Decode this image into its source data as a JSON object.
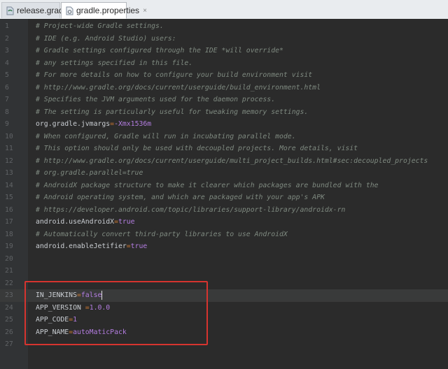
{
  "tabs": [
    {
      "label": "release.gradle",
      "close": "×",
      "icon": "gradle-file-icon",
      "active": false
    },
    {
      "label": "gradle.properties",
      "close": "×",
      "icon": "properties-file-icon",
      "active": true
    }
  ],
  "lines": [
    {
      "n": "1",
      "parts": [
        {
          "t": "# Project-wide Gradle settings.",
          "c": "comment"
        }
      ]
    },
    {
      "n": "2",
      "parts": [
        {
          "t": "# IDE (e.g. Android Studio) users:",
          "c": "comment"
        }
      ]
    },
    {
      "n": "3",
      "parts": [
        {
          "t": "# Gradle settings configured through the IDE *will override*",
          "c": "comment"
        }
      ]
    },
    {
      "n": "4",
      "parts": [
        {
          "t": "# any settings specified in this file.",
          "c": "comment"
        }
      ]
    },
    {
      "n": "5",
      "parts": [
        {
          "t": "# For more details on how to configure your build environment visit",
          "c": "comment"
        }
      ]
    },
    {
      "n": "6",
      "parts": [
        {
          "t": "# http://www.gradle.org/docs/current/userguide/build_environment.html",
          "c": "comment"
        }
      ]
    },
    {
      "n": "7",
      "parts": [
        {
          "t": "# Specifies the JVM arguments used for the daemon process.",
          "c": "comment"
        }
      ]
    },
    {
      "n": "8",
      "parts": [
        {
          "t": "# The setting is particularly useful for tweaking memory settings.",
          "c": "comment"
        }
      ]
    },
    {
      "n": "9",
      "parts": [
        {
          "t": "org.gradle.jvmargs",
          "c": "key"
        },
        {
          "t": "=",
          "c": "op"
        },
        {
          "t": "-Xmx1536m",
          "c": "strv"
        }
      ]
    },
    {
      "n": "10",
      "parts": [
        {
          "t": "# When configured, Gradle will run in incubating parallel mode.",
          "c": "comment"
        }
      ]
    },
    {
      "n": "11",
      "parts": [
        {
          "t": "# This option should only be used with decoupled projects. More details, visit",
          "c": "comment"
        }
      ]
    },
    {
      "n": "12",
      "parts": [
        {
          "t": "# http://www.gradle.org/docs/current/userguide/multi_project_builds.html#sec:decoupled_projects",
          "c": "comment"
        }
      ]
    },
    {
      "n": "13",
      "parts": [
        {
          "t": "# org.gradle.parallel=true",
          "c": "comment"
        }
      ]
    },
    {
      "n": "14",
      "parts": [
        {
          "t": "# AndroidX package structure to make it clearer which packages are bundled with the",
          "c": "comment"
        }
      ]
    },
    {
      "n": "15",
      "parts": [
        {
          "t": "# Android operating system, and which are packaged with your app's APK",
          "c": "comment"
        }
      ]
    },
    {
      "n": "16",
      "parts": [
        {
          "t": "# https://developer.android.com/topic/libraries/support-library/androidx-rn",
          "c": "comment"
        }
      ]
    },
    {
      "n": "17",
      "parts": [
        {
          "t": "android.useAndroidX",
          "c": "key"
        },
        {
          "t": "=",
          "c": "op"
        },
        {
          "t": "true",
          "c": "strv"
        }
      ]
    },
    {
      "n": "18",
      "parts": [
        {
          "t": "# Automatically convert third-party libraries to use AndroidX",
          "c": "comment"
        }
      ]
    },
    {
      "n": "19",
      "parts": [
        {
          "t": "android.enableJetifier",
          "c": "key"
        },
        {
          "t": "=",
          "c": "op"
        },
        {
          "t": "true",
          "c": "strv"
        }
      ]
    },
    {
      "n": "20",
      "parts": []
    },
    {
      "n": "21",
      "parts": []
    },
    {
      "n": "22",
      "parts": []
    },
    {
      "n": "23",
      "parts": [
        {
          "t": "IN_JENKINS",
          "c": "key"
        },
        {
          "t": "=",
          "c": "op"
        },
        {
          "t": "false",
          "c": "strv"
        }
      ],
      "current": true
    },
    {
      "n": "24",
      "parts": [
        {
          "t": "APP_VERSION ",
          "c": "key"
        },
        {
          "t": "=",
          "c": "op"
        },
        {
          "t": "1.0.0",
          "c": "strv"
        }
      ]
    },
    {
      "n": "25",
      "parts": [
        {
          "t": "APP_CODE",
          "c": "key"
        },
        {
          "t": "=",
          "c": "op"
        },
        {
          "t": "1",
          "c": "strv"
        }
      ]
    },
    {
      "n": "26",
      "parts": [
        {
          "t": "APP_NAME",
          "c": "key"
        },
        {
          "t": "=",
          "c": "op"
        },
        {
          "t": "autoMaticPack",
          "c": "strv"
        }
      ]
    },
    {
      "n": "27",
      "parts": []
    }
  ],
  "colors": {
    "highlight_box": "#d6342f",
    "editor_bg": "#2b2b2b",
    "comment": "#7f8a80",
    "value": "#b37de0"
  }
}
